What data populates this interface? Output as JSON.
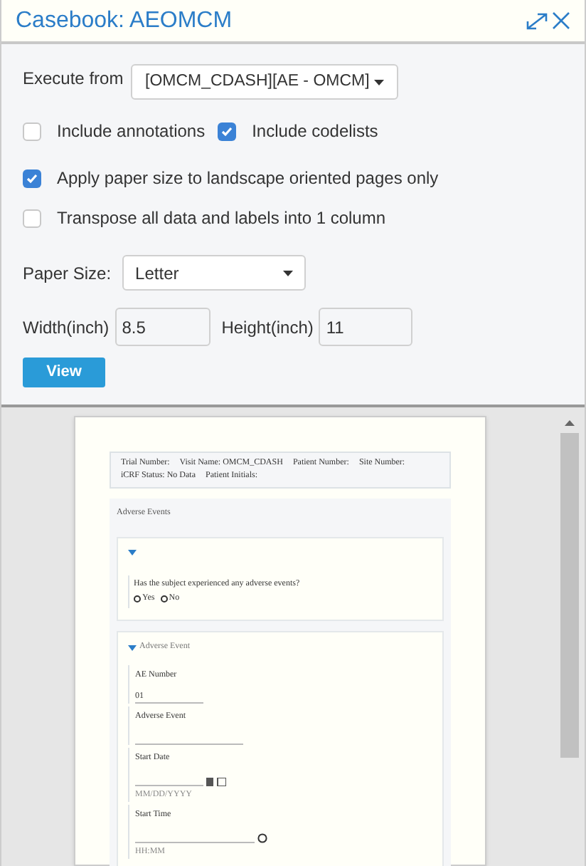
{
  "window": {
    "title": "Casebook: AEOMCM"
  },
  "execute_from": {
    "label": "Execute from",
    "value": "[OMCM_CDASH][AE - OMCM]"
  },
  "option_rows": [
    [
      {
        "label": "Include annotations",
        "checked": false
      },
      {
        "label": "Include codelists",
        "checked": true
      }
    ],
    [
      {
        "label": "Apply paper size to landscape oriented pages only",
        "checked": true
      }
    ],
    [
      {
        "label": "Transpose all data and labels into 1 column",
        "checked": false
      }
    ]
  ],
  "paper_size": {
    "label": "Paper Size:",
    "value": "Letter"
  },
  "width": {
    "label": "Width(inch)",
    "value": "8.5"
  },
  "height": {
    "label": "Height(inch)",
    "value": "11"
  },
  "view_button": "View",
  "preview": {
    "header": [
      "Trial Number:",
      "Visit Name: OMCM_CDASH",
      "Patient Number:",
      "Site Number:",
      "iCRF Status: No Data",
      "Patient Initials:"
    ],
    "section_title": "Adverse Events",
    "question": "Has the subject experienced any adverse events?",
    "choices": [
      {
        "label": "Yes",
        "selected": false
      },
      {
        "label": "No",
        "selected": false
      }
    ],
    "subsection_title": "Adverse Event",
    "fields": [
      {
        "label": "AE Number",
        "value": "01",
        "kind": "text"
      },
      {
        "label": "Adverse Event",
        "kind": "text"
      },
      {
        "label": "Start Date",
        "kind": "date",
        "hint": "MM/DD/YYYY"
      },
      {
        "label": "Start Time",
        "kind": "time",
        "hint": "HH:MM"
      }
    ]
  }
}
